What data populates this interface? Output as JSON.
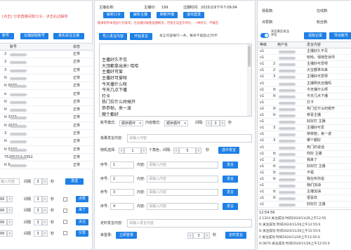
{
  "top_hint": "[点击] 分享直播间复口令，点击右边解析",
  "top_buttons": [
    "账号",
    "云端获取账号",
    "真实关注主播"
  ],
  "left_table": {
    "headers": [
      "账号",
      "",
      "状态"
    ],
    "rows": [
      {
        "acc": "2",
        "status": "正常"
      },
      {
        "acc": "2",
        "status": "正常"
      },
      {
        "acc": "3",
        "status": "正常"
      },
      {
        "acc": "tt",
        "status": "正常"
      },
      {
        "acc": "tt                   0670",
        "status": "正常"
      },
      {
        "acc": "a",
        "status": "正常"
      },
      {
        "acc": "tt",
        "status": "正常"
      },
      {
        "acc": "tt",
        "status": "正常"
      },
      {
        "acc": "tt                   3315",
        "status": "正常"
      },
      {
        "acc": "tt                   2673",
        "status": "正常"
      },
      {
        "acc": "3",
        "status": "正常"
      },
      {
        "acc": "tt",
        "status": "正常"
      },
      {
        "acc": "tt                   5337",
        "status": "正常"
      },
      {
        "acc": "                     75285714_0352",
        "status": "正常"
      },
      {
        "acc": "tt                   6",
        "status": "正常"
      }
    ]
  },
  "left_bottom": {
    "input_placeholder": "输入内容",
    "interval_label": "间隔",
    "interval_value": "3",
    "unit": "秒",
    "send_label": "发送",
    "rows": [
      {
        "v": "99",
        "interval": "间隔",
        "n": "3",
        "unit": "秒",
        "btn": "点赞"
      },
      {
        "v": "99",
        "interval": "间隔",
        "n": "3",
        "unit": "秒",
        "btn": "来了"
      },
      {
        "v": "99",
        "interval": "间隔",
        "n": "3",
        "unit": "秒",
        "btn": "关注"
      },
      {
        "v": "99",
        "interval": "间隔",
        "n": "3",
        "unit": "秒",
        "btn": "分享"
      }
    ]
  },
  "header_info": {
    "host_label": "主播名称:",
    "host_id_label": "主播ID:",
    "host_id_value": "199",
    "expire_label": "过期时间:",
    "expire_value": "2025/2/9下午7:09:04",
    "buttons": [
      "解析口令",
      "解析主播",
      "刷新开播",
      "退出登录"
    ],
    "warning": "敬请软件本地运行勿关闭，在直播间观看直播网页，否则无法显示评论，一律封号，不做后"
  },
  "actions": {
    "import_btn": "导入发言内容",
    "start_btn": "开始发言",
    "hint": "发言内容每行一条，每条不能超过30字"
  },
  "messages": [
    "主播好久不见",
    "大顶都拿出来! 哈哈",
    "主播好可爱",
    "主播好可爱呀",
    "今天播什么呀",
    "今天几点下播",
    "打卡",
    "热门位什么时候开",
    "恭恭勃，来一波",
    "哪个都好",
    "热门的说话"
  ],
  "mode_row": {
    "account_mode_label": "账号模式:",
    "account_mode": "顺序循环",
    "content_mode_label": "内容模式:",
    "content_mode": "顺序循环",
    "interval_label": "间隔:",
    "interval_value": "3",
    "unit": "秒"
  },
  "batch": {
    "label": "批量发言内容:",
    "placeholder": "请输入内容"
  },
  "random_row": {
    "label": "随机选择:",
    "count_value": "1",
    "count_label": "个角色，间隔:",
    "interval_value": "5",
    "unit": "秒",
    "button": "选中发言"
  },
  "seq_rows": [
    {
      "seq_label": "序号:",
      "seq": "1",
      "content_label": "内容:",
      "placeholder": "请输入内容",
      "btn": "发言"
    },
    {
      "seq_label": "序号:",
      "seq": "2",
      "content_label": "内容:",
      "placeholder": "请输入内容",
      "btn": "发言"
    },
    {
      "seq_label": "序号:",
      "seq": "3",
      "content_label": "内容:",
      "placeholder": "请输入内容",
      "btn": "发言"
    },
    {
      "seq_label": "序号:",
      "seq": "4",
      "content_label": "内容:",
      "placeholder": "请输入内容",
      "btn": "发言"
    }
  ],
  "timed": {
    "label": "定时发言内容:",
    "placeholder": "请输入发言内容",
    "login_label": "来登录:",
    "login_btn": "立即登录",
    "interval_value": "3",
    "unit": "秒",
    "timed_btn": "定时发言"
  },
  "stats": {
    "viewers_label": "观看数:",
    "online_label": "在线数:",
    "likes_label": "点赞数:",
    "fans_label": "粉丝数:"
  },
  "right_toolbar": {
    "toggle_label": "开启真实关注评论",
    "clear_btn": "清除记录",
    "export_btn": "导出账号"
  },
  "log_table": {
    "headers": [
      "等级",
      "用户名",
      "发言内容"
    ],
    "rows": [
      {
        "lv": "v1",
        "user": "",
        "content": "主播好久不见"
      },
      {
        "lv": "v1",
        "user": "",
        "content": "哈哈，悄悄告诉你"
      },
      {
        "lv": "v1",
        "user": "2",
        "content": "主播好可爱呀"
      },
      {
        "lv": "v1",
        "user": "2",
        "content": "大宝都拿出来"
      },
      {
        "lv": "v1",
        "user": "3",
        "content": "主播好可爱呀"
      },
      {
        "lv": "v1",
        "user": "",
        "content": "主播明天还播吗"
      },
      {
        "lv": "v1",
        "user": "tt",
        "content": "今天播什么呀"
      },
      {
        "lv": "v1",
        "user": "tt",
        "content": "今天几点下播"
      },
      {
        "lv": "v1",
        "user": "",
        "content": "打卡"
      },
      {
        "lv": "v1",
        "user": "tt",
        "content": "热门位什么时候开"
      },
      {
        "lv": "v1",
        "user": "tt",
        "content": "恭喜主播"
      },
      {
        "lv": "v1",
        "user": "",
        "content": "好好打 主播"
      },
      {
        "lv": "v1",
        "user": "3",
        "content": "主播好可爱"
      },
      {
        "lv": "v1",
        "user": "",
        "content": "恭恭勃，来一波"
      },
      {
        "lv": "v1",
        "user": "3",
        "content": "哪个都好"
      },
      {
        "lv": "v1",
        "user": "",
        "content": "热门的说话"
      },
      {
        "lv": "v1",
        "user": "tt",
        "content": "你好 主播"
      },
      {
        "lv": "v1",
        "user": "2",
        "content": "我来了"
      },
      {
        "lv": "v1",
        "user": "tt",
        "content": "好好打 主播"
      },
      {
        "lv": "v1",
        "user": "tt",
        "content": "不错"
      },
      {
        "lv": "v1",
        "user": "tt",
        "content": "我在听你说"
      },
      {
        "lv": "v1",
        "user": "",
        "content": "我们加油"
      },
      {
        "lv": "v1",
        "user": "tt",
        "content": "主播加油"
      },
      {
        "lv": "v1",
        "user": "tt",
        "content": "很喜欢"
      },
      {
        "lv": "v1",
        "user": "",
        "content": "好好打 主播"
      }
    ]
  },
  "status_log": {
    "time": "12:54:56",
    "lines": [
      "2           1314 关注成功 时间2024/11/26上午12:55",
      "tt          关注成功 时间2024/11/26上午12:55:0",
      "tt          关注成功 时间2024/11/26上午12:55:0",
      "2           关注成功 时间2024/11/26上午12:55:0",
      "tt          0670 关注成功 时间2024/11/26上午12:55:0"
    ]
  }
}
